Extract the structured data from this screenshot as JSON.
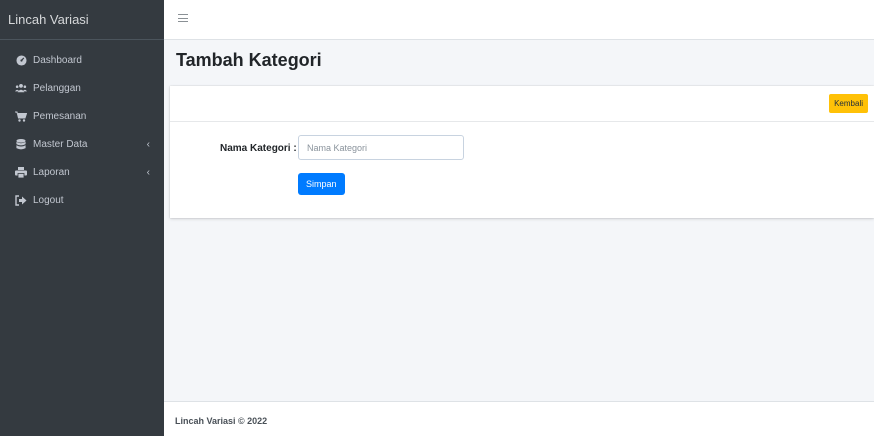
{
  "brand": {
    "name": "Lincah Variasi"
  },
  "sidebar": {
    "items": [
      {
        "label": "Dashboard",
        "icon": "tachometer-icon"
      },
      {
        "label": "Pelanggan",
        "icon": "users-icon"
      },
      {
        "label": "Pemesanan",
        "icon": "cart-icon"
      },
      {
        "label": "Master Data",
        "icon": "database-icon",
        "has_submenu": true
      },
      {
        "label": "Laporan",
        "icon": "print-icon",
        "has_submenu": true
      },
      {
        "label": "Logout",
        "icon": "sign-out-icon"
      }
    ]
  },
  "page": {
    "title": "Tambah Kategori"
  },
  "card": {
    "back_label": "Kembali"
  },
  "form": {
    "category_label": "Nama Kategori :",
    "category_value": "",
    "category_placeholder": "Nama Kategori",
    "save_label": "Simpan"
  },
  "footer": {
    "text": "Lincah Variasi © 2022"
  },
  "colors": {
    "sidebar": "#343a40",
    "primary": "#007bff",
    "warning": "#ffc107",
    "background": "#f4f6f9"
  }
}
